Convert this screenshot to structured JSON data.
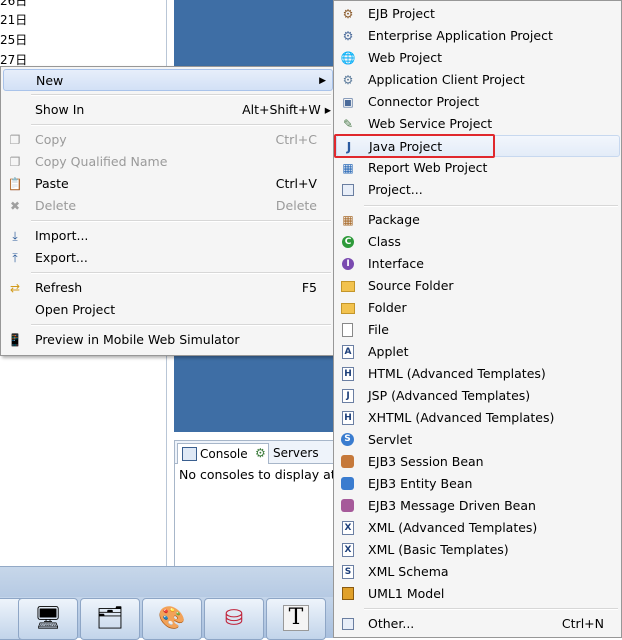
{
  "tree": {
    "lines": [
      "26日",
      "21日",
      "25日",
      "27日"
    ]
  },
  "context_menu": {
    "items": [
      {
        "label": "New",
        "accel": "",
        "enabled": true,
        "submenu": true,
        "icon": "none"
      },
      {
        "label": "Show In",
        "accel": "Alt+Shift+W ▸",
        "enabled": true,
        "icon": "none"
      },
      {
        "label": "Copy",
        "accel": "Ctrl+C",
        "enabled": false,
        "icon": "copy-icon"
      },
      {
        "label": "Copy Qualified Name",
        "accel": "",
        "enabled": false,
        "icon": "copy-qualified-icon"
      },
      {
        "label": "Paste",
        "accel": "Ctrl+V",
        "enabled": true,
        "icon": "paste-icon"
      },
      {
        "label": "Delete",
        "accel": "Delete",
        "enabled": false,
        "icon": "delete-icon"
      },
      {
        "label": "Import...",
        "accel": "",
        "enabled": true,
        "icon": "import-icon"
      },
      {
        "label": "Export...",
        "accel": "",
        "enabled": true,
        "icon": "export-icon"
      },
      {
        "label": "Refresh",
        "accel": "F5",
        "enabled": true,
        "icon": "refresh-icon"
      },
      {
        "label": "Open Project",
        "accel": "",
        "enabled": true,
        "icon": "none"
      },
      {
        "label": "Preview in Mobile Web Simulator",
        "accel": "",
        "enabled": true,
        "icon": "mobile-icon"
      }
    ]
  },
  "submenu": {
    "items": [
      {
        "label": "EJB Project",
        "icon": "ejb-project-icon"
      },
      {
        "label": "Enterprise Application Project",
        "icon": "enterprise-project-icon"
      },
      {
        "label": "Web Project",
        "icon": "web-project-icon"
      },
      {
        "label": "Application Client Project",
        "icon": "app-client-project-icon"
      },
      {
        "label": "Connector Project",
        "icon": "connector-project-icon"
      },
      {
        "label": "Web Service Project",
        "icon": "web-service-project-icon"
      },
      {
        "label": "Java Project",
        "icon": "java-project-icon"
      },
      {
        "label": "Report Web Project",
        "icon": "report-web-project-icon"
      },
      {
        "label": "Project...",
        "icon": "project-icon"
      },
      {
        "label": "Package",
        "icon": "package-icon"
      },
      {
        "label": "Class",
        "icon": "class-icon"
      },
      {
        "label": "Interface",
        "icon": "interface-icon"
      },
      {
        "label": "Source Folder",
        "icon": "source-folder-icon"
      },
      {
        "label": "Folder",
        "icon": "folder-icon"
      },
      {
        "label": "File",
        "icon": "file-icon"
      },
      {
        "label": "Applet",
        "icon": "applet-icon"
      },
      {
        "label": "HTML (Advanced Templates)",
        "icon": "html-icon"
      },
      {
        "label": "JSP (Advanced Templates)",
        "icon": "jsp-icon"
      },
      {
        "label": "XHTML (Advanced Templates)",
        "icon": "xhtml-icon"
      },
      {
        "label": "Servlet",
        "icon": "servlet-icon"
      },
      {
        "label": "EJB3 Session Bean",
        "icon": "session-bean-icon"
      },
      {
        "label": "EJB3 Entity Bean",
        "icon": "entity-bean-icon"
      },
      {
        "label": "EJB3 Message Driven Bean",
        "icon": "message-bean-icon"
      },
      {
        "label": "XML (Advanced Templates)",
        "icon": "xml-advanced-icon"
      },
      {
        "label": "XML (Basic Templates)",
        "icon": "xml-basic-icon"
      },
      {
        "label": "XML Schema",
        "icon": "xml-schema-icon"
      },
      {
        "label": "UML1 Model",
        "icon": "uml-model-icon"
      },
      {
        "label": "Other...",
        "accel": "Ctrl+N",
        "icon": "other-icon"
      }
    ]
  },
  "console": {
    "tab_console": "Console",
    "tab_servers": "Servers",
    "message": "No consoles to display at t"
  },
  "colors": {
    "editor_bg": "#3e6ea5",
    "highlight_box": "#e0282d"
  }
}
